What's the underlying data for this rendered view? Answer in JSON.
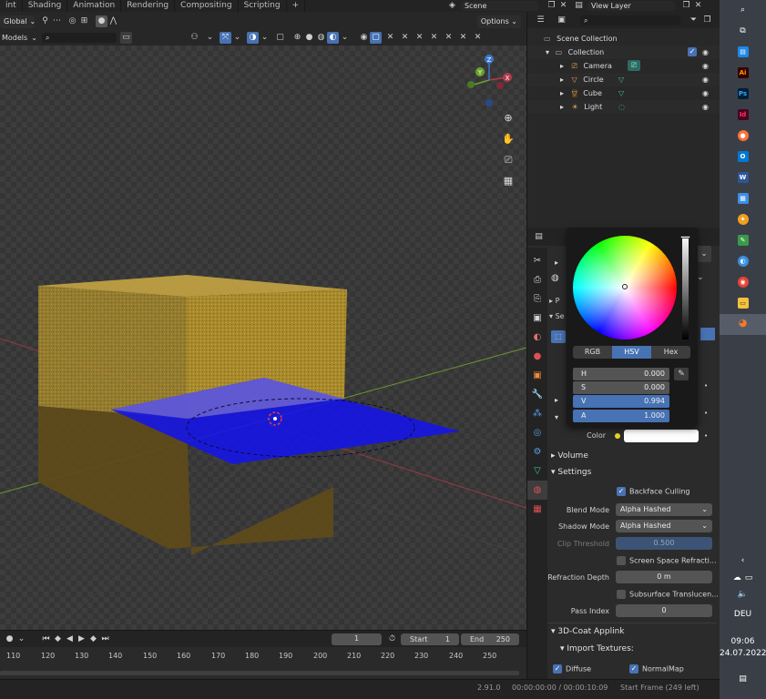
{
  "workspace_tabs": [
    "int",
    "Shading",
    "Animation",
    "Rendering",
    "Compositing",
    "Scripting",
    "+"
  ],
  "scene_name": "Scene",
  "view_layer_name": "View Layer",
  "viewport_header": {
    "orientation": "Global",
    "options_label": "Options",
    "models_label": "Models"
  },
  "outliner": {
    "root": "Scene Collection",
    "collection": "Collection",
    "items": [
      "Camera",
      "Circle",
      "Cube",
      "Light"
    ]
  },
  "color_picker": {
    "modes": [
      "RGB",
      "HSV",
      "Hex"
    ],
    "active_mode": "HSV",
    "fields": [
      {
        "label": "H",
        "value": "0.000"
      },
      {
        "label": "S",
        "value": "0.000"
      },
      {
        "label": "V",
        "value": "0.994"
      },
      {
        "label": "A",
        "value": "1.000"
      }
    ]
  },
  "properties": {
    "partial_labels": [
      "P",
      "Se"
    ],
    "color_label": "Color",
    "volume_section": "Volume",
    "settings_section": "Settings",
    "backface_culling": "Backface Culling",
    "blend_mode_label": "Blend Mode",
    "blend_mode_value": "Alpha Hashed",
    "shadow_mode_label": "Shadow Mode",
    "shadow_mode_value": "Alpha Hashed",
    "clip_threshold_label": "Clip Threshold",
    "clip_threshold_value": "0.500",
    "screen_space_refraction": "Screen Space Refracti...",
    "refraction_depth_label": "Refraction Depth",
    "refraction_depth_value": "0 m",
    "subsurface_translucency": "Subsurface Translucen...",
    "pass_index_label": "Pass Index",
    "pass_index_value": "0",
    "applink_section": "3D-Coat Applink",
    "import_textures": "Import Textures:",
    "diffuse": "Diffuse",
    "normalmap": "NormalMap"
  },
  "timeline": {
    "current_frame": "1",
    "start_label": "Start",
    "start_value": "1",
    "end_label": "End",
    "end_value": "250",
    "ticks": [
      "110",
      "120",
      "130",
      "140",
      "150",
      "160",
      "170",
      "180",
      "190",
      "200",
      "210",
      "220",
      "230",
      "240",
      "250"
    ]
  },
  "statusbar": {
    "version": "2.91.0",
    "time": "00:00:00:00 / 00:00:10:09",
    "start_frame": "Start Frame (249 left)"
  },
  "taskbar": {
    "language": "DEU",
    "clock_time": "09:06",
    "clock_date": "24.07.2022"
  },
  "colors": {
    "accent": "#4772b3",
    "cube": "#b39634",
    "plane": "#1515e6",
    "panel": "#2b2b2b"
  }
}
